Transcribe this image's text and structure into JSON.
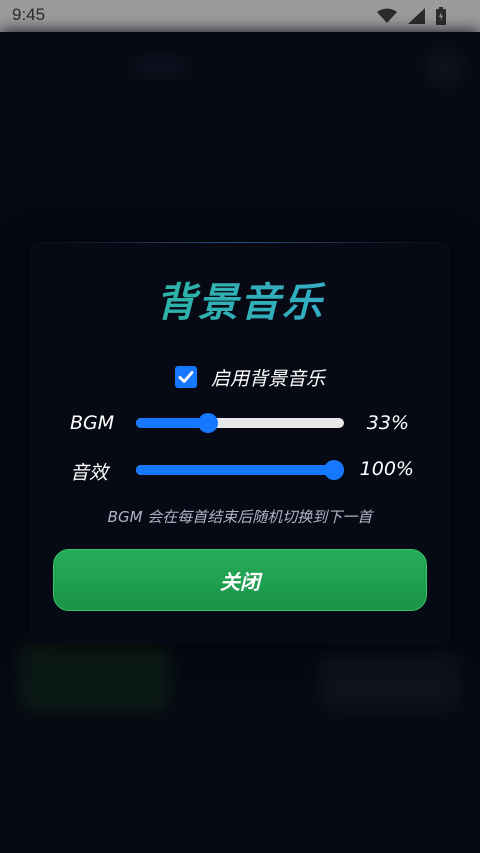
{
  "status_bar": {
    "time": "9:45",
    "icons": [
      "wifi-icon",
      "cell-signal-icon",
      "battery-icon"
    ]
  },
  "dialog": {
    "title": "背景音乐",
    "enable_checkbox": {
      "label": "启用背景音乐",
      "checked": true
    },
    "sliders": [
      {
        "label": "BGM",
        "value": 33,
        "display": "33%"
      },
      {
        "label": "音效",
        "value": 100,
        "display": "100%"
      }
    ],
    "hint": "BGM 会在每首结束后随机切换到下一首",
    "close_label": "关闭"
  },
  "colors": {
    "accent": "#1677ff",
    "button_green": "#1f9e4f",
    "title_gradient_start": "#27b78b",
    "title_gradient_end": "#3aa8e0",
    "background": "#0a0d18"
  }
}
